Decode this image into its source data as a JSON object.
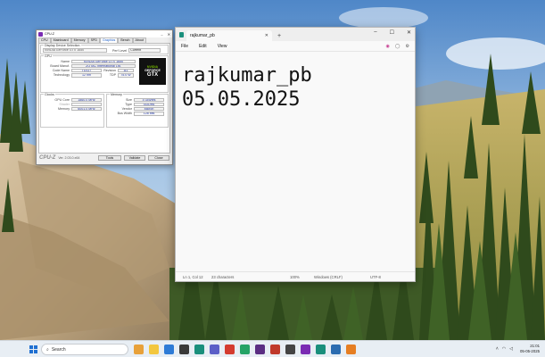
{
  "cpuz": {
    "title": "CPU-Z",
    "tabs": [
      "CPU",
      "Mainboard",
      "Memory",
      "SPD",
      "Graphics",
      "Bench",
      "About"
    ],
    "display_selection_label": "Display Device Selection",
    "device_value": "NVIDIA GeForce GTX 1650",
    "perf_level_label": "Perf Level",
    "perf_level_value": "Current",
    "gpu_group": "GPU",
    "name_label": "Name",
    "name_value": "NVIDIA GeForce GTX 1650",
    "board_label": "Board Manuf.",
    "board_value": "ZOTAC International Ltd.",
    "codename_label": "Code Name",
    "codename_value": "TU117",
    "revision_label": "Revision",
    "revision_value": "A1",
    "technology_label": "Technology",
    "technology_value": "12 nm",
    "tdp_label": "TDP",
    "tdp_value": "75.0 W",
    "clocks_group": "Clocks",
    "gpu_core_label": "GPU Core",
    "gpu_core_value": "1860.0 MHz",
    "shader_label": "Shader",
    "shader_value": "",
    "memory_clock_label": "Memory",
    "memory_clock_value": "6001.0 MHz",
    "memory_group": "Memory",
    "size_label": "Size",
    "size_value": "4 GBytes",
    "type_label": "Type",
    "type_value": "GDDR6",
    "vendor_label": "Vendor",
    "vendor_value": "Micron",
    "buswidth_label": "Bus Width",
    "buswidth_value": "128 bits",
    "logo_line1": "NVIDIA",
    "logo_line2": "GEFORCE",
    "logo_line3": "GTX",
    "brand": "CPU-Z",
    "version": "Ver. 2.03.0.x64",
    "tools_button": "Tools",
    "validate_button": "Validate",
    "close_button": "Close"
  },
  "notepad": {
    "tab_title": "rajkumar_pb",
    "menu_file": "File",
    "menu_edit": "Edit",
    "menu_view": "View",
    "line1": "rajkumar_pb",
    "line2": "",
    "line3": "05.05.2025",
    "status_position": "Ln 1, Col 12",
    "status_chars": "23 characters",
    "status_zoom": "100%",
    "status_eol": "Windows (CRLF)",
    "status_encoding": "UTF-8"
  },
  "taskbar": {
    "search_placeholder": "Search",
    "time": "21:01",
    "date": "05-05-2025"
  }
}
